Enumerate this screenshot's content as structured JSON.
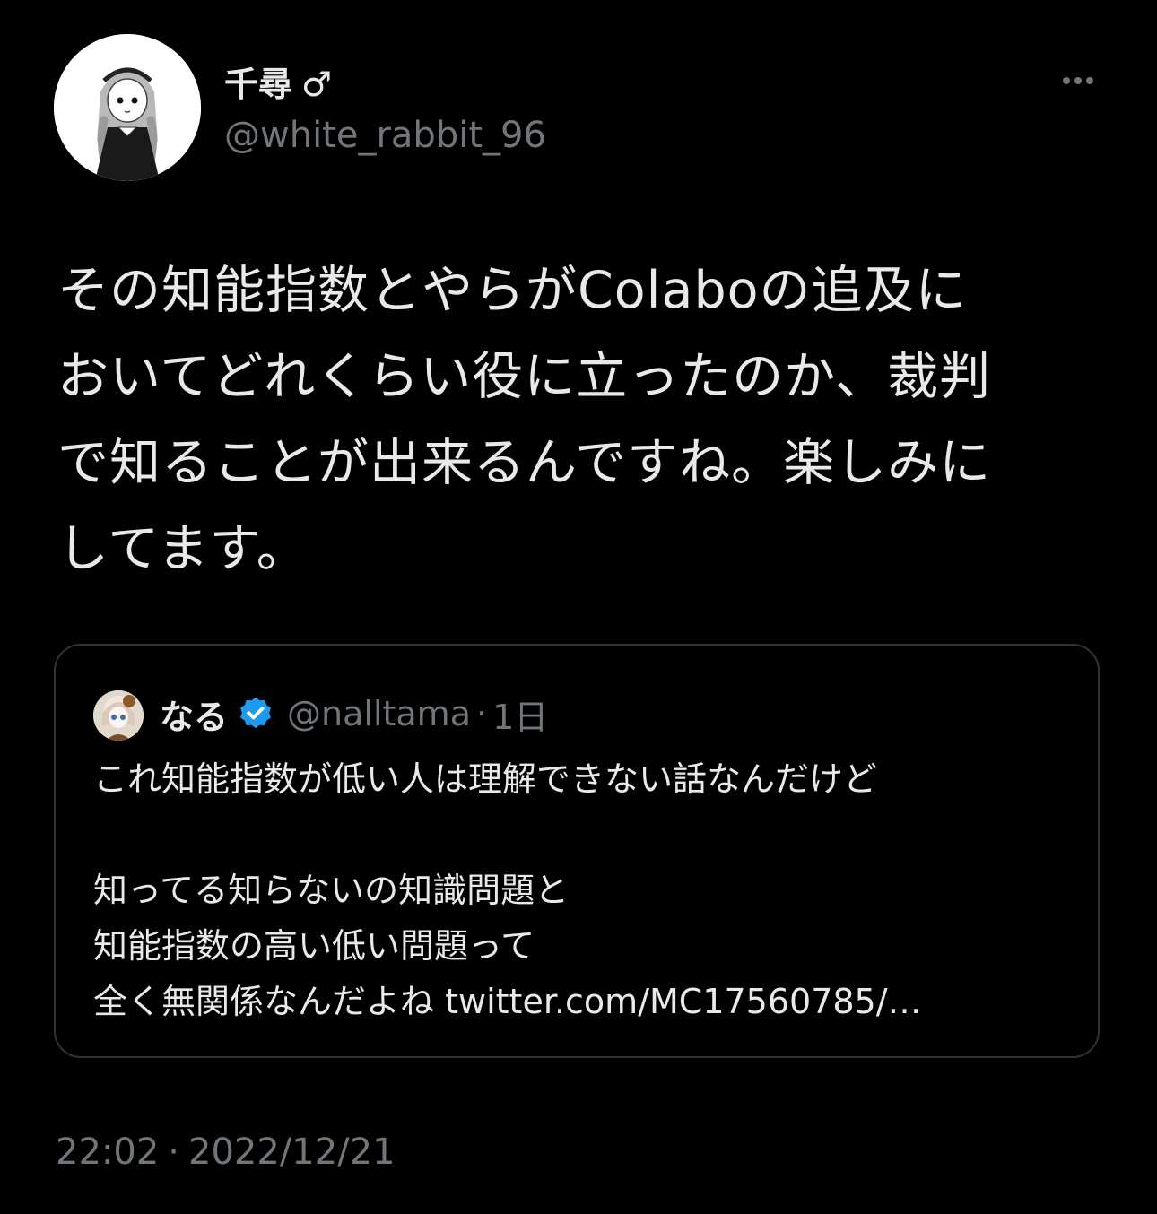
{
  "author": {
    "display_name": "千尋",
    "gender_symbol": "♂",
    "handle": "@white_rabbit_96",
    "avatar_text": "white rabbit"
  },
  "tweet": {
    "lines": [
      "その知能指数とやらがColaboの追及に",
      "おいてどれくらい役に立ったのか、裁判",
      "で知ることが出来るんですね。楽しみに",
      "してます。"
    ]
  },
  "quote": {
    "name": "なる",
    "handle": "@nalltama",
    "separator": "·",
    "time": "1日",
    "lines": [
      "これ知能指数が低い人は理解できない話なんだけど",
      "",
      "知ってる知らないの知識問題と",
      "知能指数の高い低い問題って",
      "全く無関係なんだよね"
    ],
    "link": "twitter.com/MC17560785/…"
  },
  "footer": {
    "time": "22:02",
    "separator": "·",
    "date": "2022/12/21"
  },
  "colors": {
    "background": "#000000",
    "text_primary": "#e7e9ea",
    "text_secondary": "#71767b",
    "border": "#2f3336",
    "verified": "#1d9bf0"
  }
}
